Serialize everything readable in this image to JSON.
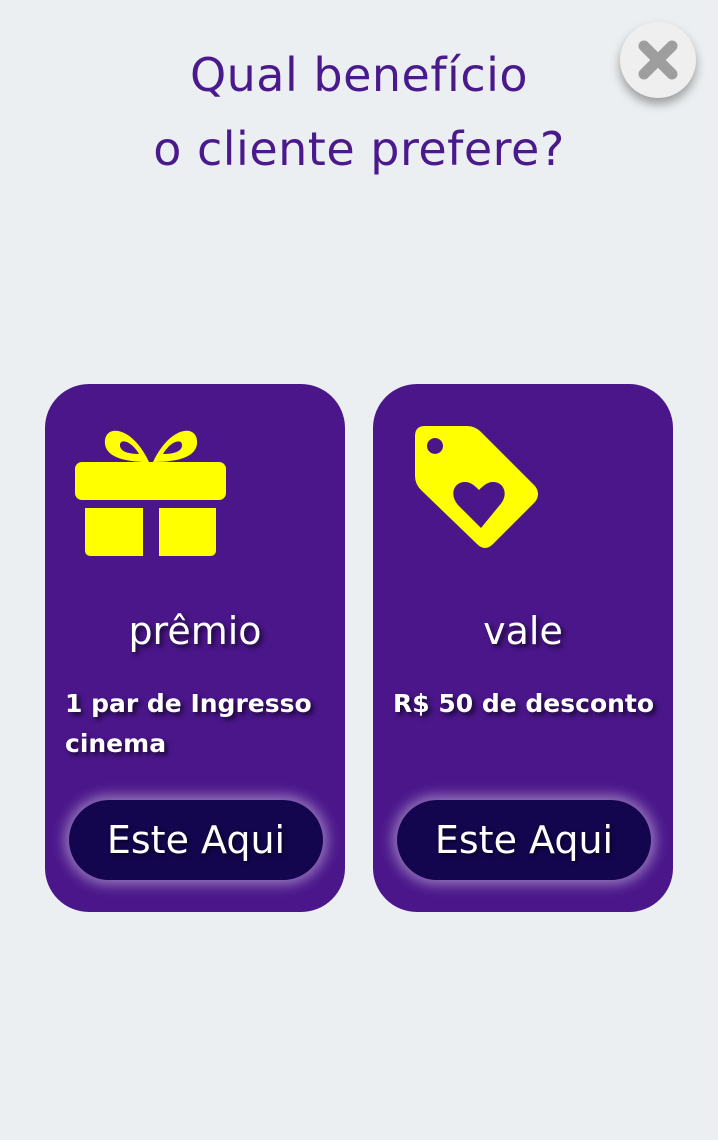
{
  "header": {
    "title_line1": "Qual benefício",
    "title_line2": "o cliente prefere?"
  },
  "close_button": {
    "icon": "close-icon"
  },
  "options": [
    {
      "icon": "gift-icon",
      "heading": "prêmio",
      "description": "1 par de Ingresso cinema",
      "button_label": "Este Aqui"
    },
    {
      "icon": "tag-heart-icon",
      "heading": "vale",
      "description": "R$ 50 de desconto",
      "button_label": "Este Aqui"
    }
  ],
  "colors": {
    "background": "#eceff1",
    "title": "#4a1a8c",
    "card": "#4a168a",
    "icon": "#ffff00",
    "button": "#13064f",
    "close_button": "#efefef",
    "close_icon": "#9e9e9e"
  }
}
